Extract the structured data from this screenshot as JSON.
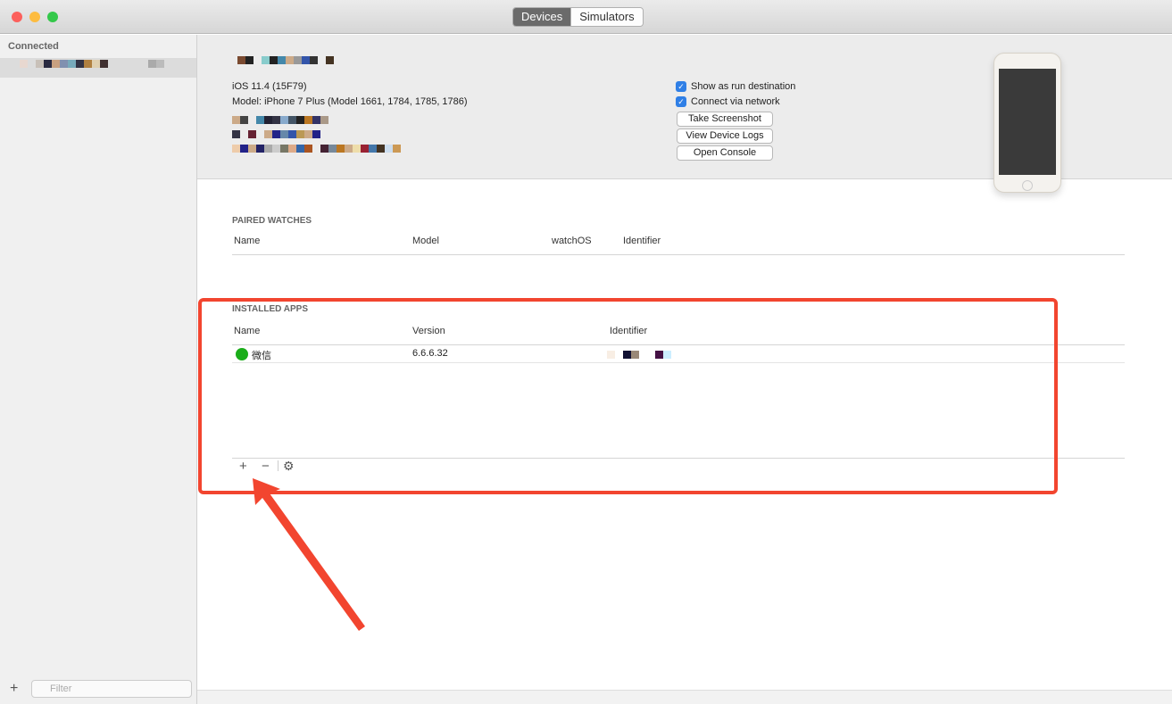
{
  "window": {
    "tabs": [
      {
        "label": "Devices",
        "selected": true
      },
      {
        "label": "Simulators",
        "selected": false
      }
    ]
  },
  "sidebar": {
    "section": "Connected",
    "filter_placeholder": "Filter",
    "add_label": "+"
  },
  "device": {
    "os": "iOS 11.4 (15F79)",
    "model": "Model: iPhone 7 Plus (Model 1661, 1784, 1785, 1786)",
    "options": [
      {
        "label": "Show as run destination",
        "checked": true
      },
      {
        "label": "Connect via network",
        "checked": true
      }
    ],
    "buttons": {
      "screenshot": "Take Screenshot",
      "logs": "View Device Logs",
      "console": "Open Console"
    }
  },
  "paired_watches": {
    "title": "PAIRED WATCHES",
    "columns": [
      "Name",
      "Model",
      "watchOS",
      "Identifier"
    ]
  },
  "installed_apps": {
    "title": "INSTALLED APPS",
    "columns": [
      "Name",
      "Version",
      "Identifier"
    ],
    "rows": [
      {
        "name": "微信",
        "version": "6.6.6.32"
      }
    ],
    "toolbar": {
      "add": "+",
      "remove": "−"
    }
  },
  "annotation": {
    "color": "#f2452f"
  }
}
